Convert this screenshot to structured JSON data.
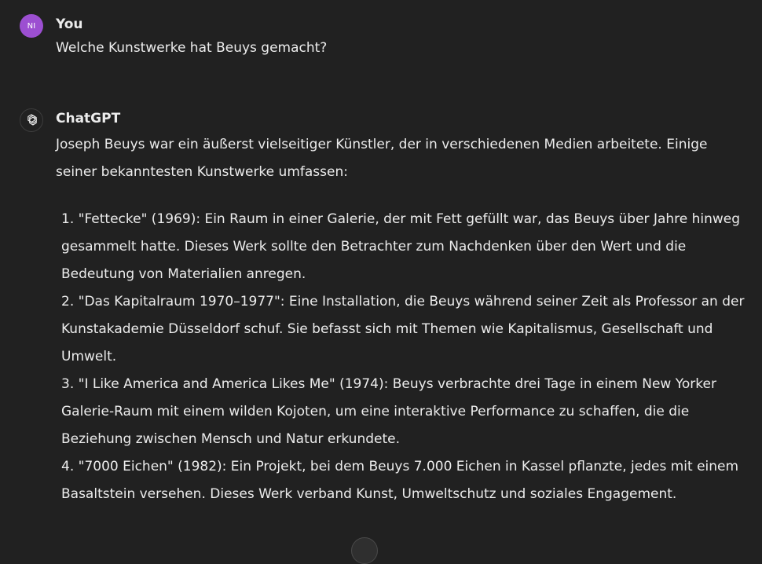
{
  "user_message": {
    "avatar_initials": "NI",
    "author": "You",
    "text": "Welche Kunstwerke hat Beuys gemacht?"
  },
  "assistant_message": {
    "avatar_icon": "openai-logo-icon",
    "author": "ChatGPT",
    "intro": "Joseph Beuys war ein äußerst vielseitiger Künstler, der in verschiedenen Medien arbeitete. Einige seiner bekanntesten Kunstwerke umfassen:",
    "items": [
      "1. \"Fettecke\" (1969): Ein Raum in einer Galerie, der mit Fett gefüllt war, das Beuys über Jahre hinweg gesammelt hatte. Dieses Werk sollte den Betrachter zum Nachdenken über den Wert und die Bedeutung von Materialien anregen.",
      "2. \"Das Kapitalraum 1970–1977\": Eine Installation, die Beuys während seiner Zeit als Professor an der Kunstakademie Düsseldorf schuf. Sie befasst sich mit Themen wie Kapitalismus, Gesellschaft und Umwelt.",
      "3. \"I Like America and America Likes Me\" (1974): Beuys verbrachte drei Tage in einem New Yorker Galerie-Raum mit einem wilden Kojoten, um eine interaktive Performance zu schaffen, die die Beziehung zwischen Mensch und Natur erkundete.",
      "4. \"7000 Eichen\" (1982): Ein Projekt, bei dem Beuys 7.000 Eichen in Kassel pflanzte, jedes mit einem Basaltstein versehen. Dieses Werk verband Kunst, Umweltschutz und soziales Engagement."
    ]
  },
  "colors": {
    "background": "#212121",
    "text": "#ececec",
    "user_avatar": "#9c4fd1"
  }
}
